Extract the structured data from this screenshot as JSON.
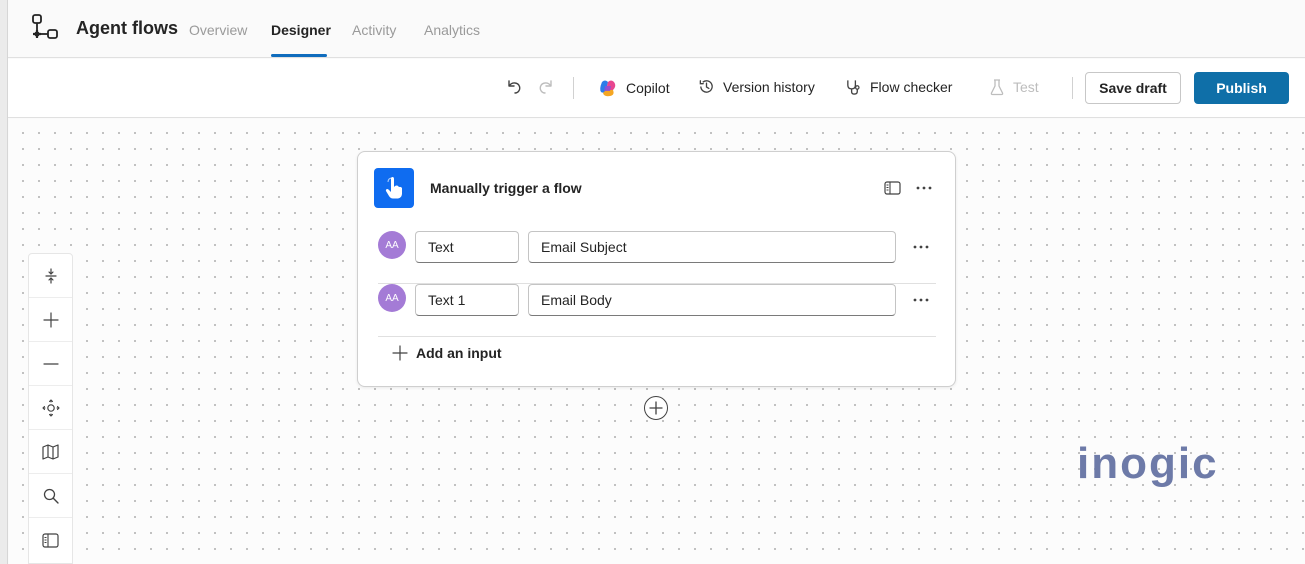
{
  "header": {
    "app_title": "Agent flows",
    "tabs": [
      {
        "label": "Overview",
        "active": false
      },
      {
        "label": "Designer",
        "active": true
      },
      {
        "label": "Activity",
        "active": false
      },
      {
        "label": "Analytics",
        "active": false
      }
    ]
  },
  "toolbar": {
    "copilot_label": "Copilot",
    "version_history_label": "Version history",
    "flow_checker_label": "Flow checker",
    "test_label": "Test",
    "save_draft_label": "Save draft",
    "publish_label": "Publish"
  },
  "trigger_card": {
    "title": "Manually trigger a flow",
    "inputs": [
      {
        "avatar": "AA",
        "type": "Text",
        "name": "Email Subject"
      },
      {
        "avatar": "AA",
        "type": "Text 1",
        "name": "Email Body"
      }
    ],
    "add_input_label": "Add an input"
  },
  "watermark": {
    "text": "inogic"
  },
  "colors": {
    "accent": "#0f6cbd",
    "publish": "#0f6fa8",
    "trigger_icon": "#0f6cf0",
    "avatar": "#a47bd6",
    "watermark": "#6d7aa8"
  },
  "icons": {
    "app": "agent-flow-icon",
    "undo": "undo-icon",
    "redo": "redo-icon",
    "copilot": "copilot-icon",
    "version_history": "history-icon",
    "flow_checker": "stethoscope-icon",
    "test": "beaker-icon",
    "zoom_controls": [
      "fit-height-icon",
      "zoom-in-icon",
      "zoom-out-icon",
      "center-icon",
      "minimap-icon",
      "search-icon",
      "panel-icon"
    ]
  }
}
